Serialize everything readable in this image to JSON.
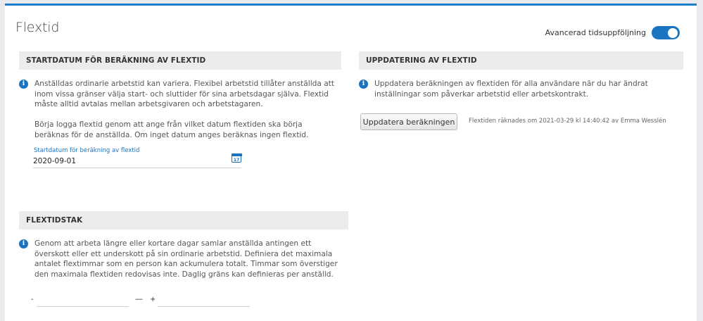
{
  "page": {
    "title": "Flextid",
    "toggle": {
      "label": "Avancerad tidsuppföljning",
      "on": true
    }
  },
  "start": {
    "header": "Startdatum för beräkning av flextid",
    "info_p1": "Anställdas ordinarie arbetstid kan variera. Flexibel arbetstid tillåter anställda att inom vissa gränser välja start- och sluttider för sina arbetsdagar själva. Flextid måste alltid avtalas mellan arbetsgivaren och arbetstagaren.",
    "info_p2": "Börja logga flextid genom att ange från vilket datum flextiden ska börja beräknas för de anställda. Om inget datum anges beräknas ingen flextid.",
    "field_label": "Startdatum för beräkning av flextid",
    "field_value": "2020-09-01",
    "calendar_day": "17"
  },
  "update": {
    "header": "Uppdatering av flextid",
    "info": "Uppdatera beräkningen av flextiden för alla användare när du har ändrat inställningar som påverkar arbetstid eller arbetskontrakt.",
    "button": "Uppdatera beräkningen",
    "note": "Flextiden räknades om 2021-03-29 kl 14:40:42 av Emma Wesslén"
  },
  "cap": {
    "header": "Flextidstak",
    "info": "Genom att arbeta längre eller kortare dagar samlar anställda antingen ett överskott eller ett underskott på sin ordinarie arbetstid. Definiera det maximala antalet flextimmar som en person kan ackumulera totalt. Timmar som överstiger den maximala flextiden redovisas inte. Daglig gräns kan definieras per anställd.",
    "minus_sign": "-",
    "separator": "—",
    "plus_sign": "+"
  }
}
